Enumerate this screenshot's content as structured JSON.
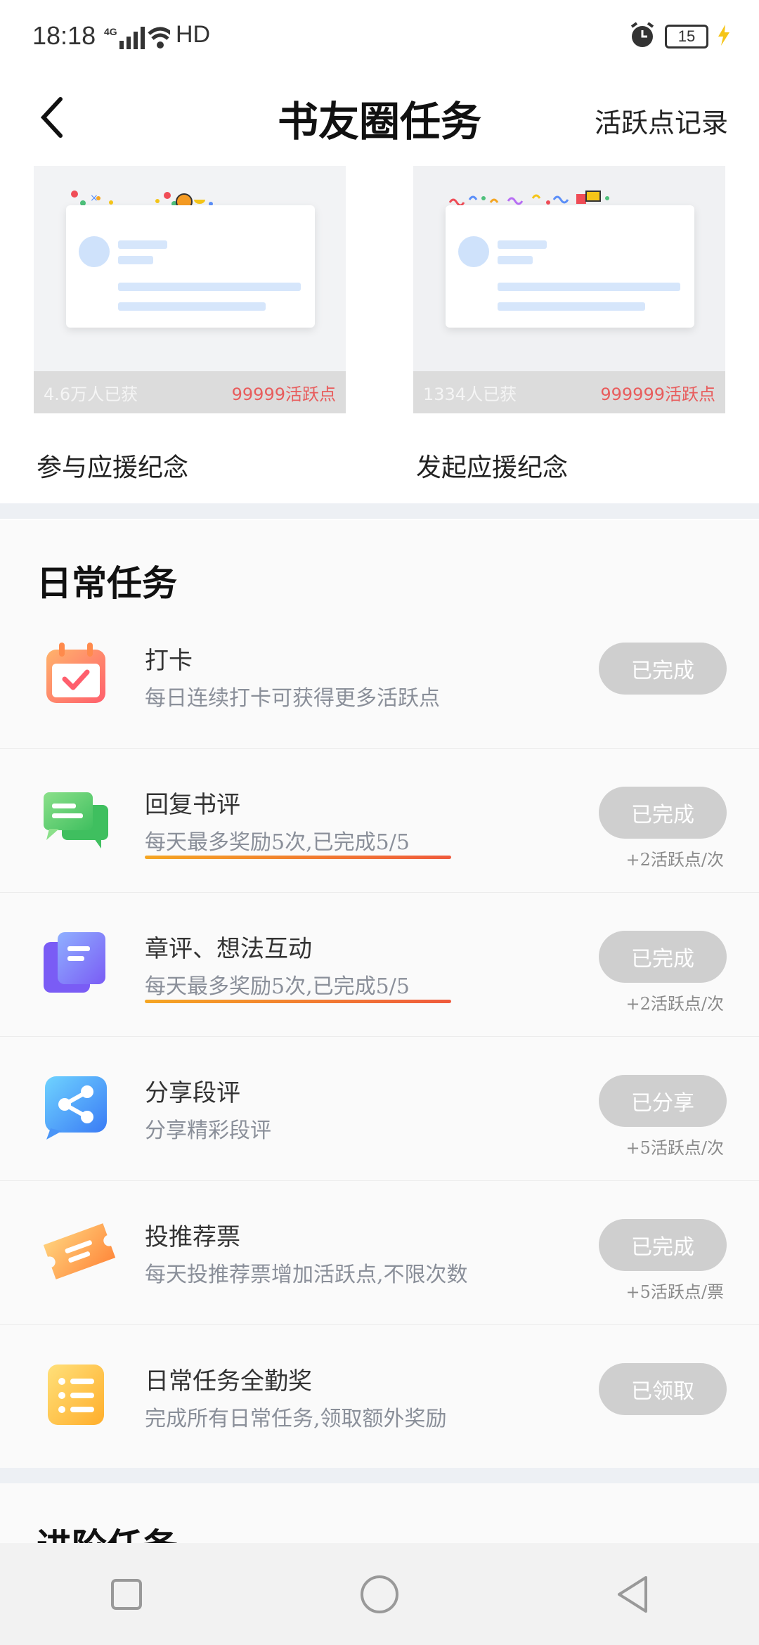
{
  "status_bar": {
    "time": "18:18",
    "network": "4G",
    "hd": "HD",
    "battery": "15"
  },
  "header": {
    "title": "书友圈任务",
    "record_link": "活跃点记录"
  },
  "support_cards": [
    {
      "count": "4.6万人已获",
      "points": "99999活跃点",
      "label": "参与应援纪念"
    },
    {
      "count": "1334人已获",
      "points": "999999活跃点",
      "label": "发起应援纪念"
    }
  ],
  "daily": {
    "title": "日常任务",
    "tasks": [
      {
        "icon": "calendar-check-icon",
        "title": "打卡",
        "desc": "每日连续打卡可获得更多活跃点",
        "button": "已完成",
        "points": ""
      },
      {
        "icon": "chat-bubbles-icon",
        "title": "回复书评",
        "desc": "每天最多奖励5次,已完成5/5",
        "button": "已完成",
        "points": "+2活跃点/次"
      },
      {
        "icon": "document-stack-icon",
        "title": "章评、想法互动",
        "desc": "每天最多奖励5次,已完成5/5",
        "button": "已完成",
        "points": "+2活跃点/次"
      },
      {
        "icon": "share-icon",
        "title": "分享段评",
        "desc": "分享精彩段评",
        "button": "已分享",
        "points": "+5活跃点/次"
      },
      {
        "icon": "ticket-icon",
        "title": "投推荐票",
        "desc": "每天投推荐票增加活跃点,不限次数",
        "button": "已完成",
        "points": "+5活跃点/票"
      },
      {
        "icon": "checklist-icon",
        "title": "日常任务全勤奖",
        "desc": "完成所有日常任务,领取额外奖励",
        "button": "已领取",
        "points": ""
      }
    ]
  },
  "advanced": {
    "title": "进阶任务"
  },
  "colors": {
    "button_done": "#cfcfcf",
    "points_red": "#e85c5c",
    "underline_start": "#f5a623",
    "underline_end": "#ef5a3c"
  }
}
